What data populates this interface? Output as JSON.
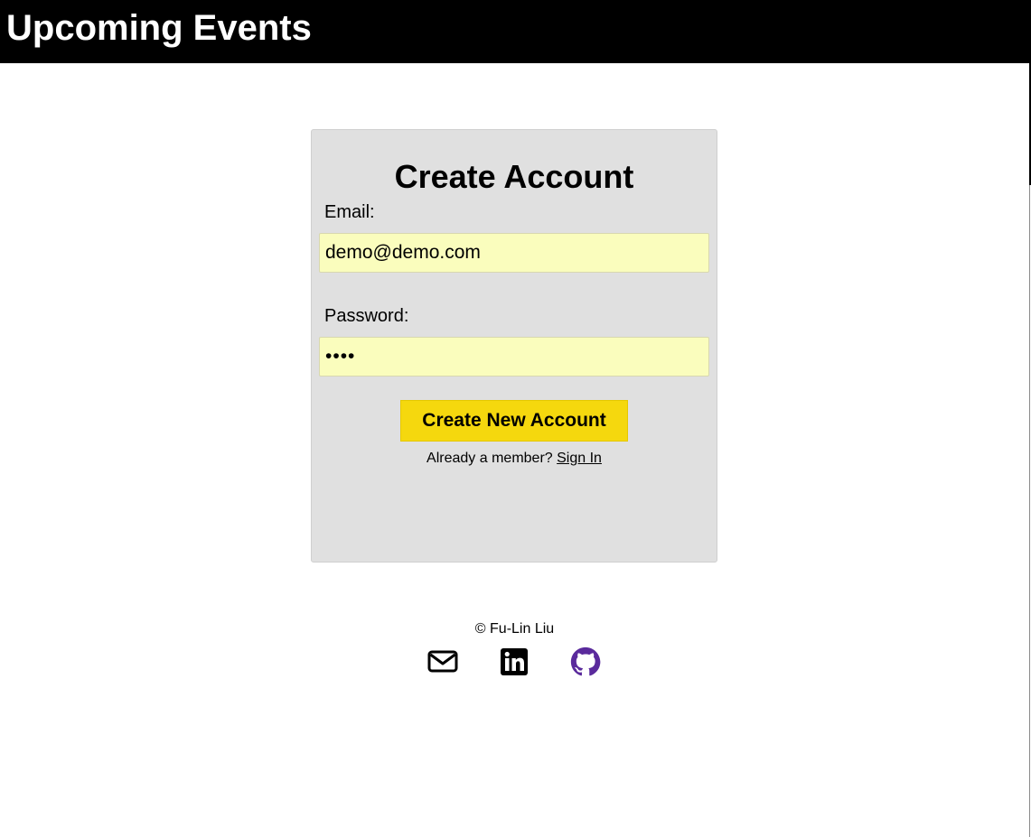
{
  "header": {
    "title": "Upcoming Events"
  },
  "form": {
    "heading": "Create Account",
    "email_label": "Email:",
    "email_value": "demo@demo.com",
    "password_label": "Password:",
    "password_value": "demo",
    "submit_label": "Create New Account",
    "member_prompt": "Already a member?",
    "sign_in_link": "Sign In"
  },
  "footer": {
    "copyright": "© Fu-Lin Liu",
    "social_icons": [
      "mail-icon",
      "linkedin-icon",
      "github-icon"
    ]
  },
  "colors": {
    "header_bg": "#000000",
    "header_text": "#ffffff",
    "card_bg": "#e0e0e0",
    "input_bg": "#fafdbd",
    "button_bg": "#f5d80e",
    "github_icon": "#5a2a9c"
  }
}
